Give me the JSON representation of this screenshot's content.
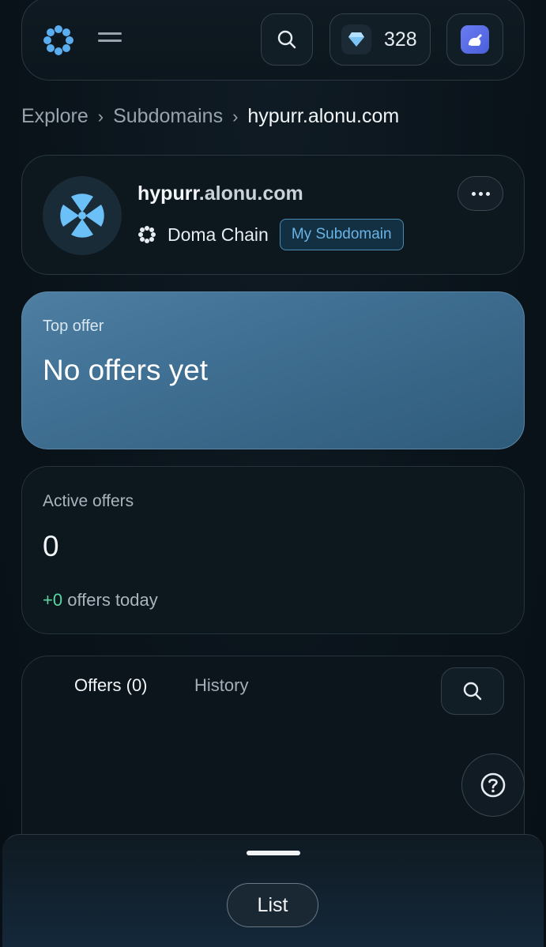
{
  "header": {
    "gem_count": "328"
  },
  "breadcrumb": {
    "items": [
      "Explore",
      "Subdomains",
      "hypurr.alonu.com"
    ]
  },
  "domain": {
    "name_prefix": "hypurr",
    "name_suffix": ".alonu.com",
    "chain": "Doma Chain",
    "badge": "My Subdomain"
  },
  "top_offer": {
    "label": "Top offer",
    "value": "No offers yet"
  },
  "active_offers": {
    "label": "Active offers",
    "count": "0",
    "today_delta": "+0",
    "today_text": " offers today"
  },
  "tabs": {
    "offers": "Offers (0)",
    "history": "History"
  },
  "sheet": {
    "button": "List"
  },
  "colors": {
    "accent": "#69b3e6",
    "positive": "#5cd6a0",
    "top_offer_bg": "#4e7fa2"
  }
}
